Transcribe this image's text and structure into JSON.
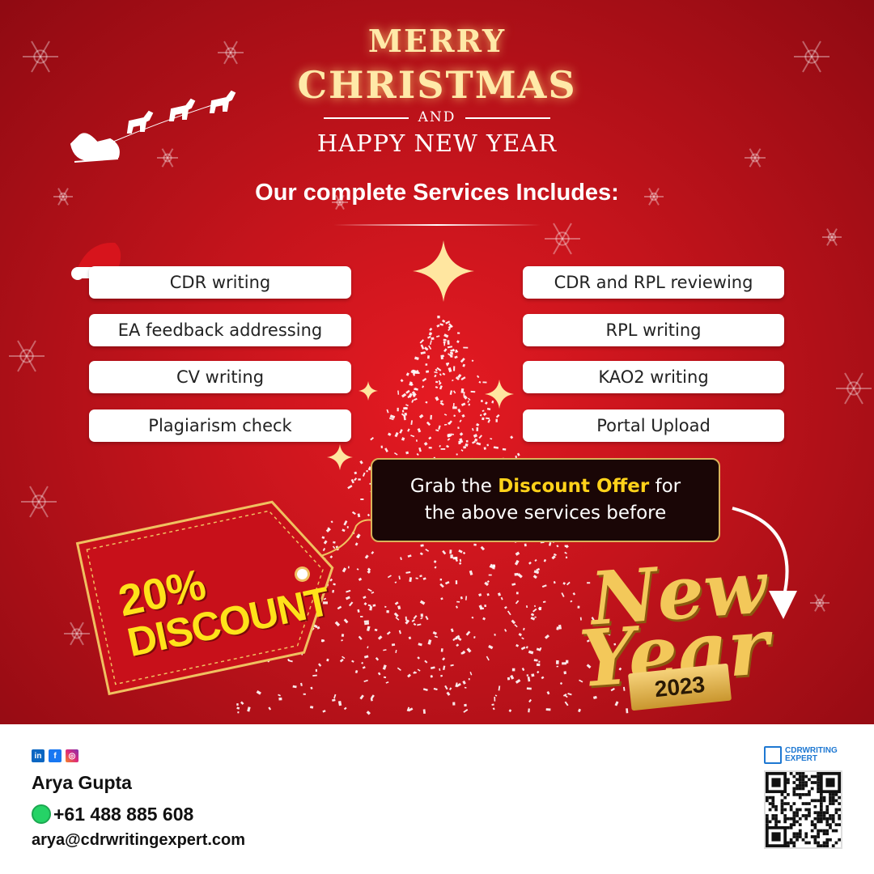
{
  "header": {
    "merry": "MERRY",
    "christmas": "CHRISTMAS",
    "and": "AND",
    "happy_new_year": "HAPPY NEW YEAR"
  },
  "services": {
    "heading": "Our complete Services Includes:",
    "left": [
      "CDR writing",
      "EA feedback addressing",
      "CV writing",
      "Plagiarism check"
    ],
    "right": [
      "CDR and RPL reviewing",
      "RPL writing",
      "KAO2 writing",
      "Portal Upload"
    ]
  },
  "offer": {
    "pre": "Grab the ",
    "highlight": "Discount Offer",
    "post": " for",
    "line2": "the above services before"
  },
  "tag": {
    "percent": "20%",
    "label": "DISCOUNT"
  },
  "new_year": {
    "new": "New",
    "year": "Year",
    "number": "2023"
  },
  "footer": {
    "social": [
      "in",
      "f",
      "ig"
    ],
    "name": "Arya Gupta",
    "phone": "+61 488 885 608",
    "email": "arya@cdrwritingexpert.com",
    "brand_line1": "CDRWRITING",
    "brand_line2": "EXPERT"
  },
  "colors": {
    "background_red": "#c5141c",
    "gold": "#f3c85a",
    "highlight_yellow": "#ffd21a",
    "brand_blue": "#1e78d2",
    "whatsapp_green": "#25d366"
  },
  "icons": [
    "santa-sleigh-icon",
    "snowflake-icon",
    "santa-hat-icon",
    "star-icon",
    "christmas-tree-icon",
    "arrow-icon",
    "whatsapp-icon",
    "linkedin-icon",
    "facebook-icon",
    "instagram-icon",
    "qr-code"
  ]
}
